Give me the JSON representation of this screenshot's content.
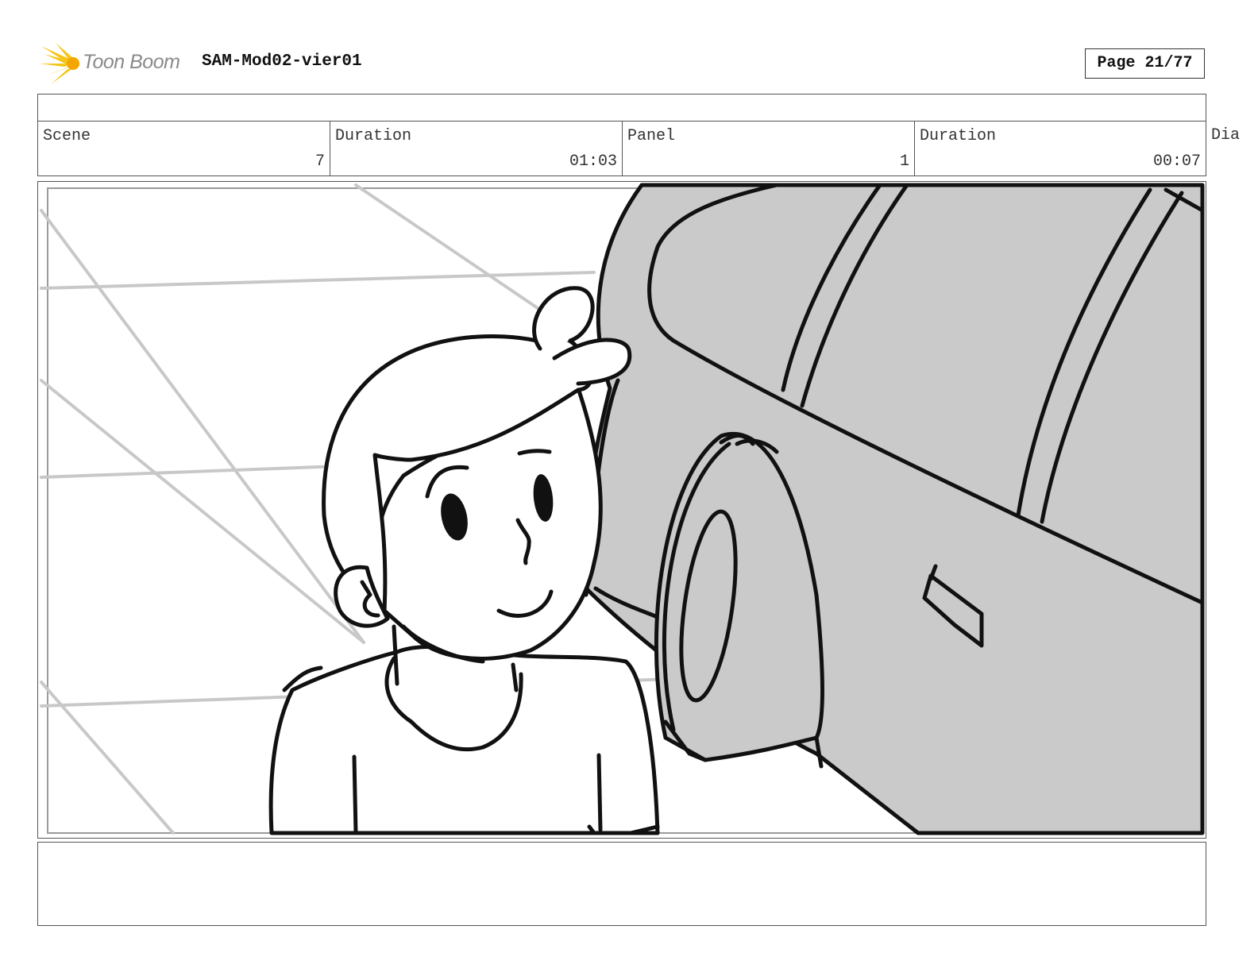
{
  "header": {
    "logo_text": "Toon Boom",
    "project_title": "SAM-Mod02-vier01",
    "page_label": "Page 21/77"
  },
  "info": {
    "scene_label": "Scene",
    "scene_value": "7",
    "scene_duration_label": "Duration",
    "scene_duration_value": "01:03",
    "panel_label": "Panel",
    "panel_value": "1",
    "panel_duration_label": "Duration",
    "panel_duration_value": "00:07",
    "dialog_label_clipped": "Dia"
  },
  "colors": {
    "logo_star": "#f5c518",
    "logo_text": "#8a8a8a",
    "car_fill": "#cacaca",
    "floor_lines": "#c8c8c8",
    "border": "#555555"
  },
  "icons": {
    "logo": "toon-boom-star-icon"
  }
}
